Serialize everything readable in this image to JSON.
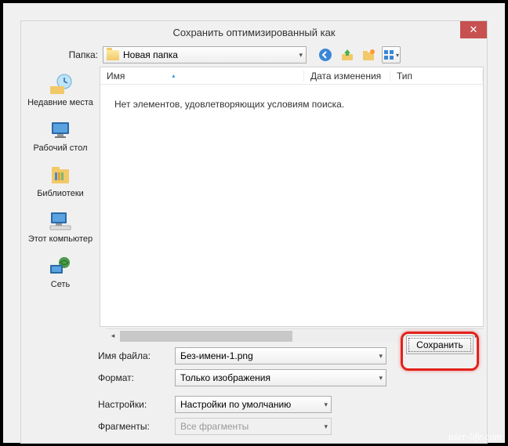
{
  "title": "Сохранить оптимизированный как",
  "toolbar": {
    "folder_label": "Папка:",
    "current_folder": "Новая папка"
  },
  "sidebar": {
    "items": [
      {
        "label": "Недавние места"
      },
      {
        "label": "Рабочий стол"
      },
      {
        "label": "Библиотеки"
      },
      {
        "label": "Этот компьютер"
      },
      {
        "label": "Сеть"
      }
    ]
  },
  "columns": {
    "name": "Имя",
    "date": "Дата изменения",
    "type": "Тип"
  },
  "empty_message": "Нет элементов, удовлетворяющих условиям поиска.",
  "form": {
    "filename_label": "Имя файла:",
    "filename_value": "Без-имени-1.png",
    "format_label": "Формат:",
    "format_value": "Только изображения",
    "settings_label": "Настройки:",
    "settings_value": "Настройки по умолчанию",
    "fragments_label": "Фрагменты:",
    "fragments_value": "Все фрагменты"
  },
  "buttons": {
    "save": "Сохранить"
  },
  "watermark": "user-life.com"
}
